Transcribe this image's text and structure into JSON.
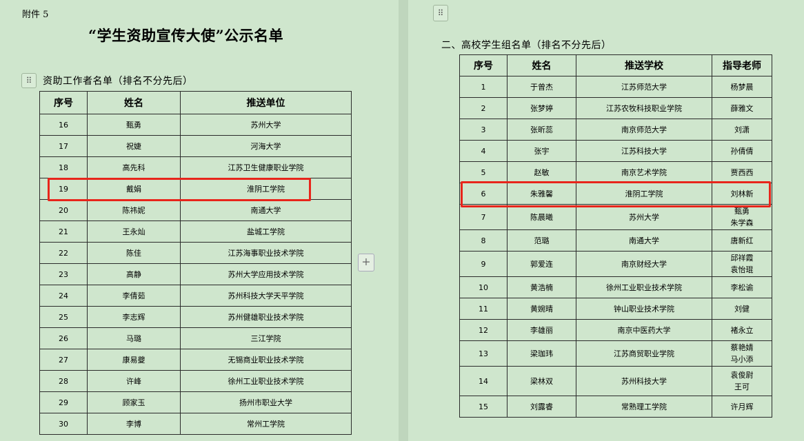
{
  "left": {
    "attachment_label": "附件 5",
    "title": "“学生资助宣传大使”公示名单",
    "section_heading": "资助工作者名单（排名不分先后）",
    "columns": [
      "序号",
      "姓名",
      "推送单位"
    ],
    "rows": [
      {
        "no": "16",
        "name": "甄勇",
        "unit": "苏州大学"
      },
      {
        "no": "17",
        "name": "祝婕",
        "unit": "河海大学"
      },
      {
        "no": "18",
        "name": "高先科",
        "unit": "江苏卫生健康职业学院"
      },
      {
        "no": "19",
        "name": "戴娟",
        "unit": "淮阴工学院"
      },
      {
        "no": "20",
        "name": "陈祎妮",
        "unit": "南通大学"
      },
      {
        "no": "21",
        "name": "王永灿",
        "unit": "盐城工学院"
      },
      {
        "no": "22",
        "name": "陈佳",
        "unit": "江苏海事职业技术学院"
      },
      {
        "no": "23",
        "name": "高静",
        "unit": "苏州大学应用技术学院"
      },
      {
        "no": "24",
        "name": "李倩茹",
        "unit": "苏州科技大学天平学院"
      },
      {
        "no": "25",
        "name": "李志辉",
        "unit": "苏州健雄职业技术学院"
      },
      {
        "no": "26",
        "name": "马璐",
        "unit": "三江学院"
      },
      {
        "no": "27",
        "name": "康易夔",
        "unit": "无锡商业职业技术学院"
      },
      {
        "no": "28",
        "name": "许峰",
        "unit": "徐州工业职业技术学院"
      },
      {
        "no": "29",
        "name": "顾家玉",
        "unit": "扬州市职业大学"
      },
      {
        "no": "30",
        "name": "李博",
        "unit": "常州工学院"
      }
    ]
  },
  "right": {
    "section_heading": "二、高校学生组名单（排名不分先后）",
    "columns": [
      "序号",
      "姓名",
      "推送学校",
      "指导老师"
    ],
    "rows": [
      {
        "no": "1",
        "name": "于曾杰",
        "school": "江苏师范大学",
        "advisor": "杨梦晨",
        "advisor2": ""
      },
      {
        "no": "2",
        "name": "张梦婷",
        "school": "江苏农牧科技职业学院",
        "advisor": "薛雅文",
        "advisor2": ""
      },
      {
        "no": "3",
        "name": "张昕蕊",
        "school": "南京师范大学",
        "advisor": "刘潇",
        "advisor2": ""
      },
      {
        "no": "4",
        "name": "张宇",
        "school": "江苏科技大学",
        "advisor": "孙倩倩",
        "advisor2": ""
      },
      {
        "no": "5",
        "name": "赵敏",
        "school": "南京艺术学院",
        "advisor": "贾西西",
        "advisor2": ""
      },
      {
        "no": "6",
        "name": "朱雅馨",
        "school": "淮阴工学院",
        "advisor": "刘林新",
        "advisor2": ""
      },
      {
        "no": "7",
        "name": "陈晨曦",
        "school": "苏州大学",
        "advisor": "甄勇",
        "advisor2": "朱学森"
      },
      {
        "no": "8",
        "name": "范璐",
        "school": "南通大学",
        "advisor": "唐新红",
        "advisor2": ""
      },
      {
        "no": "9",
        "name": "郭爱连",
        "school": "南京财经大学",
        "advisor": "邱祥霞",
        "advisor2": "袁怡琨"
      },
      {
        "no": "10",
        "name": "黄浩楠",
        "school": "徐州工业职业技术学院",
        "advisor": "李松谕",
        "advisor2": ""
      },
      {
        "no": "11",
        "name": "黄婉晴",
        "school": "钟山职业技术学院",
        "advisor": "刘健",
        "advisor2": ""
      },
      {
        "no": "12",
        "name": "李雄丽",
        "school": "南京中医药大学",
        "advisor": "褚永立",
        "advisor2": ""
      },
      {
        "no": "13",
        "name": "梁珈玮",
        "school": "江苏商贸职业学院",
        "advisor": "蔡艳婧",
        "advisor2": "马小添"
      },
      {
        "no": "14",
        "name": "梁林双",
        "school": "苏州科技大学",
        "advisor": "袁俊尉",
        "advisor2": "王可"
      },
      {
        "no": "15",
        "name": "刘露睿",
        "school": "常熟理工学院",
        "advisor": "许月辉",
        "advisor2": ""
      }
    ]
  },
  "colors": {
    "page": "#cfe6cd",
    "highlight": "#e8251b",
    "border": "#2a2a2a"
  }
}
